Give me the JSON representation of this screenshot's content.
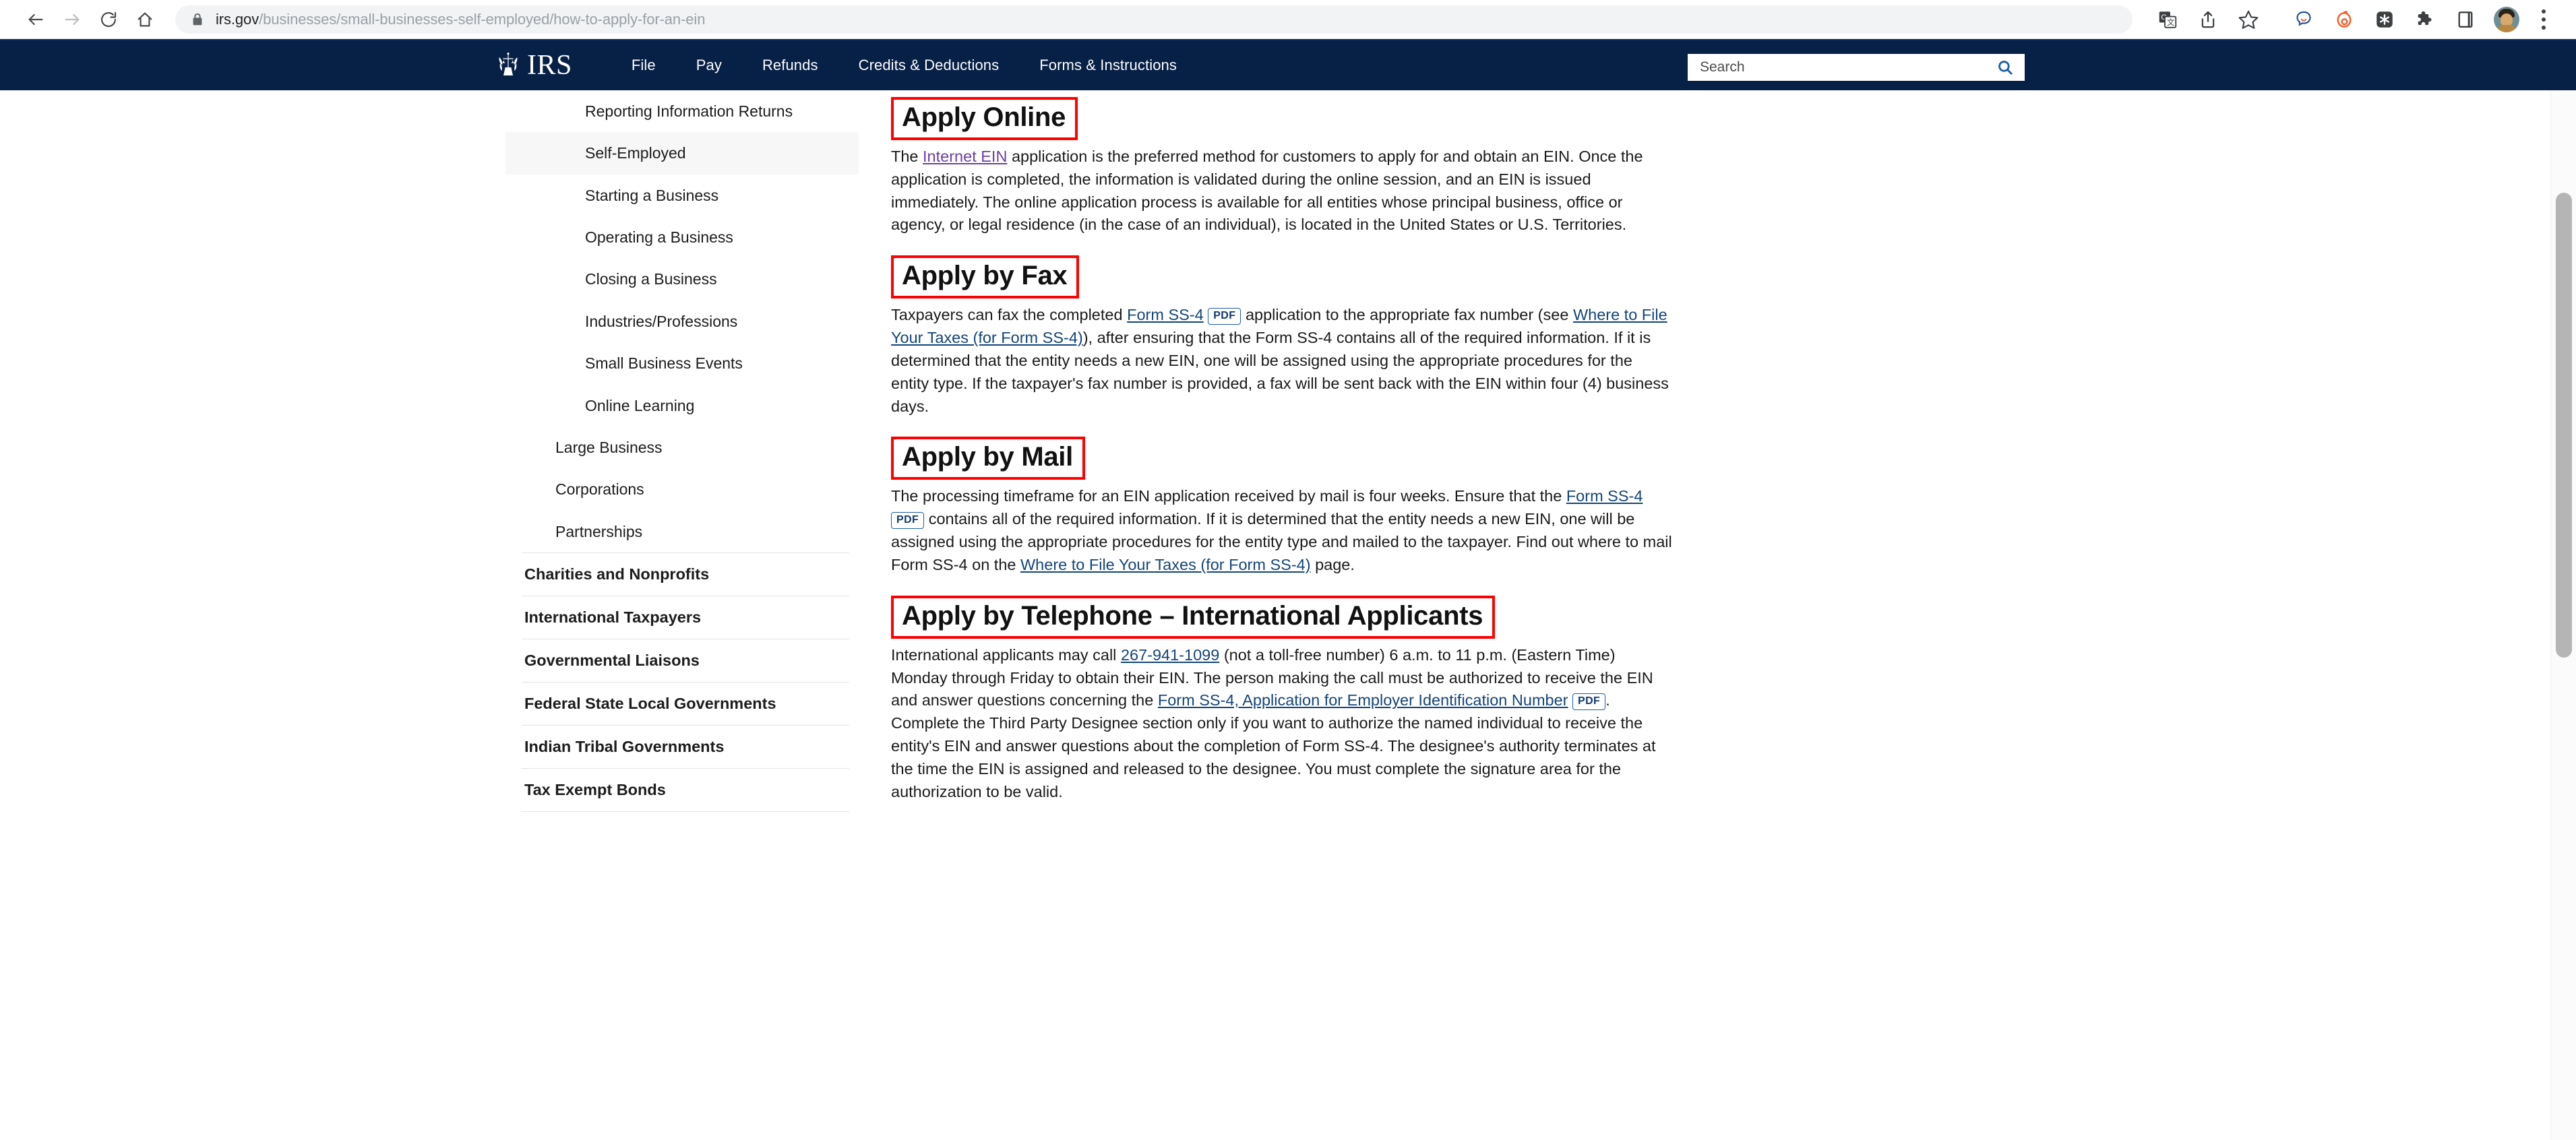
{
  "browser": {
    "nav": {
      "back_icon": "arrow-left-icon",
      "forward_icon": "arrow-right-icon",
      "reload_icon": "reload-icon",
      "home_icon": "home-icon"
    },
    "url_bar": {
      "lock_icon": "lock-icon",
      "host": "irs.gov",
      "path": "/businesses/small-businesses-self-employed/how-to-apply-for-an-ein",
      "full_url": "irs.gov/businesses/small-businesses-self-employed/how-to-apply-for-an-ein"
    },
    "actions": [
      {
        "name": "translate-icon",
        "label": "Translate"
      },
      {
        "name": "share-icon",
        "label": "Share"
      },
      {
        "name": "bookmark-star-icon",
        "label": "Bookmark"
      },
      {
        "name": "chat-bubble-icon",
        "label": "Chat extension"
      },
      {
        "name": "honey-icon",
        "label": "Honey extension"
      },
      {
        "name": "asterisk-badge-icon",
        "label": "Bitwarden extension"
      },
      {
        "name": "puzzle-piece-icon",
        "label": "Extensions"
      },
      {
        "name": "sidepanel-icon",
        "label": "Side panel"
      }
    ],
    "profile_avatar": "user-avatar",
    "menu_icon": "kebab-menu-icon"
  },
  "site_nav": {
    "logo_text": "IRS",
    "logo_icon": "irs-eagle-logo",
    "menu": [
      {
        "label": "File"
      },
      {
        "label": "Pay"
      },
      {
        "label": "Refunds"
      },
      {
        "label": "Credits & Deductions"
      },
      {
        "label": "Forms & Instructions"
      }
    ],
    "search": {
      "placeholder": "Search",
      "value": "",
      "button_icon": "search-icon"
    }
  },
  "sidebar": {
    "items": [
      {
        "label": "Reporting Information Returns",
        "style": "child",
        "active": false,
        "rule_after": false
      },
      {
        "label": "Self-Employed",
        "style": "child",
        "active": true,
        "rule_after": false
      },
      {
        "label": "Starting a Business",
        "style": "child",
        "active": false,
        "rule_after": false
      },
      {
        "label": "Operating a Business",
        "style": "child",
        "active": false,
        "rule_after": false
      },
      {
        "label": "Closing a Business",
        "style": "child",
        "active": false,
        "rule_after": false
      },
      {
        "label": "Industries/Professions",
        "style": "child",
        "active": false,
        "rule_after": false
      },
      {
        "label": "Small Business Events",
        "style": "child",
        "active": false,
        "rule_after": false
      },
      {
        "label": "Online Learning",
        "style": "child",
        "active": false,
        "rule_after": false
      },
      {
        "label": "Large Business",
        "style": "top",
        "active": false,
        "rule_after": false
      },
      {
        "label": "Corporations",
        "style": "top",
        "active": false,
        "rule_after": false
      },
      {
        "label": "Partnerships",
        "style": "top",
        "active": false,
        "rule_after": true
      },
      {
        "label": "Charities and Nonprofits",
        "style": "bold",
        "active": false,
        "rule_after": true
      },
      {
        "label": "International Taxpayers",
        "style": "bold",
        "active": false,
        "rule_after": true
      },
      {
        "label": "Governmental Liaisons",
        "style": "bold",
        "active": false,
        "rule_after": true
      },
      {
        "label": "Federal State Local Governments",
        "style": "bold",
        "active": false,
        "rule_after": true
      },
      {
        "label": "Indian Tribal Governments",
        "style": "bold",
        "active": false,
        "rule_after": true
      },
      {
        "label": "Tax Exempt Bonds",
        "style": "bold",
        "active": false,
        "rule_after": true
      }
    ]
  },
  "main": {
    "sections": [
      {
        "heading": "Apply Online",
        "highlighted": true,
        "paragraphs": [
          [
            {
              "t": "text",
              "v": "The "
            },
            {
              "t": "link",
              "v": "Internet EIN",
              "visited": true
            },
            {
              "t": "text",
              "v": " application is the preferred method for customers to apply for and obtain an EIN. Once the application is completed, the information is validated during the online session, and an EIN is issued immediately. The online application process is available for all entities whose principal business, office or agency, or legal residence (in the case of an individual), is located in the United States or U.S. Territories."
            }
          ]
        ]
      },
      {
        "heading": "Apply by Fax",
        "highlighted": true,
        "paragraphs": [
          [
            {
              "t": "text",
              "v": "Taxpayers can fax the completed "
            },
            {
              "t": "link",
              "v": "Form SS-4",
              "visited": false
            },
            {
              "t": "text",
              "v": " "
            },
            {
              "t": "pdf",
              "v": "PDF"
            },
            {
              "t": "text",
              "v": " application to the appropriate fax number (see "
            },
            {
              "t": "link",
              "v": "Where to File Your Taxes (for Form SS-4)",
              "visited": false
            },
            {
              "t": "text",
              "v": "), after ensuring that the Form SS-4 contains all of the required information. If it is determined that the entity needs a new EIN, one will be assigned using the appropriate procedures for the entity type. If the taxpayer's fax number is provided, a fax will be sent back with the EIN within four (4) business days."
            }
          ]
        ]
      },
      {
        "heading": "Apply by Mail",
        "highlighted": true,
        "paragraphs": [
          [
            {
              "t": "text",
              "v": "The processing timeframe for an EIN application received by mail is four weeks. Ensure that the "
            },
            {
              "t": "link",
              "v": "Form SS-4",
              "visited": false
            },
            {
              "t": "text",
              "v": " "
            },
            {
              "t": "pdf",
              "v": "PDF"
            },
            {
              "t": "text",
              "v": " contains all of the required information. If it is determined that the entity needs a new EIN, one will be assigned using the appropriate procedures for the entity type and mailed to the taxpayer. Find out where to mail Form SS-4 on the "
            },
            {
              "t": "link",
              "v": "Where to File Your Taxes (for Form SS-4)",
              "visited": false
            },
            {
              "t": "text",
              "v": " page."
            }
          ]
        ]
      },
      {
        "heading": "Apply by Telephone – International Applicants",
        "highlighted": true,
        "paragraphs": [
          [
            {
              "t": "text",
              "v": "International applicants may call "
            },
            {
              "t": "link",
              "v": "267-941-1099",
              "visited": false
            },
            {
              "t": "text",
              "v": " (not a toll-free number) 6 a.m. to 11 p.m. (Eastern Time) Monday through Friday to obtain their EIN. The person making the call must be authorized to receive the EIN and answer questions concerning the "
            },
            {
              "t": "link",
              "v": "Form SS-4, Application for Employer Identification Number",
              "visited": false
            },
            {
              "t": "text",
              "v": " "
            },
            {
              "t": "pdf",
              "v": "PDF"
            },
            {
              "t": "text",
              "v": ". Complete the Third Party Designee section only if you want to authorize the named individual to receive the entity's EIN and answer questions about the completion of Form SS-4. The designee's authority terminates at the time the EIN is assigned and released to the designee. You must complete the signature area for the authorization to be valid."
            }
          ]
        ]
      }
    ]
  },
  "scrollbar": {
    "name": "vertical-scrollbar"
  },
  "colors": {
    "irs_navy": "#062046",
    "annotation_red": "#ff0000",
    "link_blue": "#13457a",
    "link_visited": "#6b3fa0"
  }
}
